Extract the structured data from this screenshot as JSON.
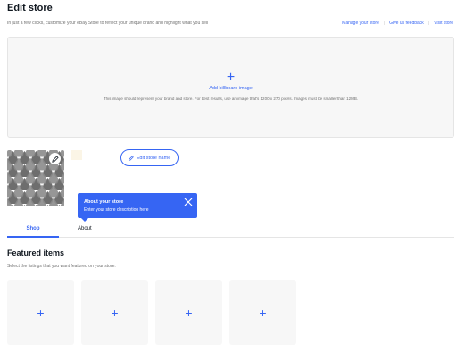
{
  "header": {
    "title": "Edit store",
    "intro": "In just a few clicks, customize your eBay Store to reflect your unique brand and highlight what you sell",
    "links": [
      "Manage your store",
      "Give us feedback",
      "Visit store"
    ]
  },
  "billboard": {
    "plus": "+",
    "add_label": "Add billboard image",
    "hint": "This image should represent your brand and store. For best results, use an image that's 1200 x 270 pixels. Images must be smaller than 12MB."
  },
  "store": {
    "edit_name_label": "Edit store name",
    "swatch_color": "#fbf5e6"
  },
  "tooltip": {
    "title": "About your store",
    "body": "Enter your store description here"
  },
  "tabs": [
    "Shop",
    "About"
  ],
  "featured": {
    "title": "Featured items",
    "subtitle": "Select the listings that you want featured on your store.",
    "slots": [
      "+",
      "+",
      "+",
      "+"
    ]
  },
  "colors": {
    "accent": "#3665f3",
    "text": "#111820",
    "muted": "#707070",
    "panel": "#f7f7f7"
  }
}
